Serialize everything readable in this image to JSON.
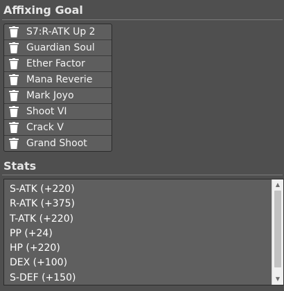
{
  "affixing_goal": {
    "heading": "Affixing Goal",
    "items": [
      {
        "label": "S7:R-ATK Up 2"
      },
      {
        "label": "Guardian Soul"
      },
      {
        "label": "Ether Factor"
      },
      {
        "label": "Mana Reverie"
      },
      {
        "label": "Mark Joyo"
      },
      {
        "label": "Shoot VI"
      },
      {
        "label": "Crack V"
      },
      {
        "label": "Grand Shoot"
      }
    ],
    "item_icon": "trash-icon"
  },
  "stats": {
    "heading": "Stats",
    "lines": [
      "S-ATK (+220)",
      "R-ATK (+375)",
      "T-ATK (+220)",
      "PP (+24)",
      "HP (+220)",
      "DEX (+100)",
      "S-DEF (+150)"
    ],
    "scroll_up_icon": "scroll-up-arrow-icon",
    "scroll_down_icon": "scroll-down-arrow-icon"
  },
  "colors": {
    "background": "#4f4f4f",
    "panel": "#5e5e5e",
    "text": "#ffffff"
  }
}
